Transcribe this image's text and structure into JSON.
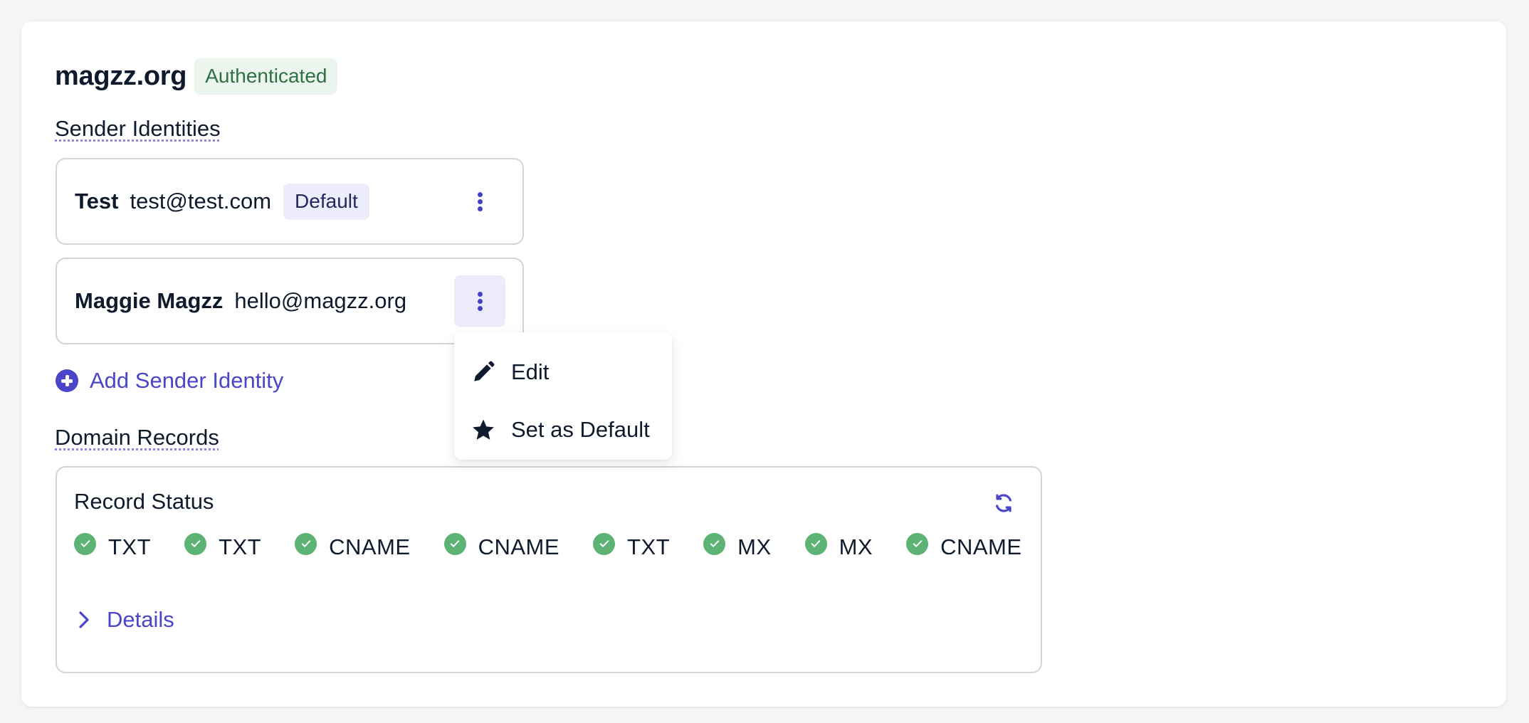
{
  "domain": {
    "name": "magzz.org",
    "status_badge": "Authenticated"
  },
  "sender_identities": {
    "section_label": "Sender Identities",
    "items": [
      {
        "name": "Test",
        "email": "test@test.com",
        "badge": "Default",
        "menu_open": false
      },
      {
        "name": "Maggie Magzz",
        "email": "hello@magzz.org",
        "badge": null,
        "menu_open": true
      }
    ],
    "add_label": "Add Sender Identity"
  },
  "identity_menu": {
    "items": [
      {
        "label": "Edit",
        "icon": "pencil-icon"
      },
      {
        "label": "Set as Default",
        "icon": "star-icon"
      }
    ]
  },
  "domain_records": {
    "section_label": "Domain Records",
    "box_title": "Record Status",
    "records": [
      {
        "type": "TXT",
        "status": "verified"
      },
      {
        "type": "TXT",
        "status": "verified"
      },
      {
        "type": "CNAME",
        "status": "verified"
      },
      {
        "type": "CNAME",
        "status": "verified"
      },
      {
        "type": "TXT",
        "status": "verified"
      },
      {
        "type": "MX",
        "status": "verified"
      },
      {
        "type": "MX",
        "status": "verified"
      },
      {
        "type": "CNAME",
        "status": "verified"
      }
    ],
    "details_label": "Details"
  },
  "colors": {
    "accent": "#4a45c9",
    "success": "#5db374",
    "auth_badge_bg": "#ebf5ee",
    "auth_badge_text": "#2f6f44",
    "default_badge_bg": "#edecfa"
  }
}
